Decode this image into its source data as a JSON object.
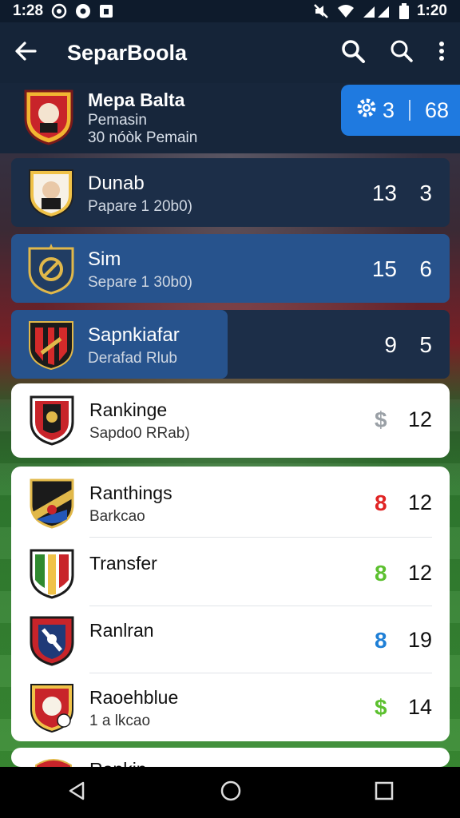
{
  "status": {
    "time_left": "1:28",
    "time_right": "1:20"
  },
  "appbar": {
    "title": "SeparBoola"
  },
  "profile": {
    "name": "Mepa Balta",
    "sub1": "Pemasin",
    "sub2": "30 nóòk Pemain",
    "score_a": "3",
    "score_b": "68"
  },
  "dark_cards": [
    {
      "name": "Dunab",
      "sub": "Papare 1 20b0)",
      "v1": "13",
      "v2": "3"
    },
    {
      "name": "Sim",
      "sub": "Separe 1 30b0)",
      "v1": "15",
      "v2": "6"
    },
    {
      "name": "Sapnkiafar",
      "sub": "Derafad Rlub",
      "v1": "9",
      "v2": "5"
    }
  ],
  "single_card": {
    "name": "Rankinge",
    "sub": "Sapdo0 RRab)",
    "mark": "$",
    "value": "12"
  },
  "list_card": [
    {
      "name": "Ranthings",
      "sub": "Barkcao",
      "mark": "8",
      "mark_color": "#e02424",
      "value": "12"
    },
    {
      "name": "Transfer",
      "sub": "",
      "mark": "8",
      "mark_color": "#5cc02f",
      "value": "12"
    },
    {
      "name": "Ranlran",
      "sub": "",
      "mark": "8",
      "mark_color": "#1e7fd6",
      "value": "19"
    },
    {
      "name": "Raoehblue",
      "sub": "1 a lkcao",
      "mark": "$",
      "mark_color": "#5cc02f",
      "value": "14"
    }
  ],
  "partial_card": {
    "name": "Rankin"
  }
}
